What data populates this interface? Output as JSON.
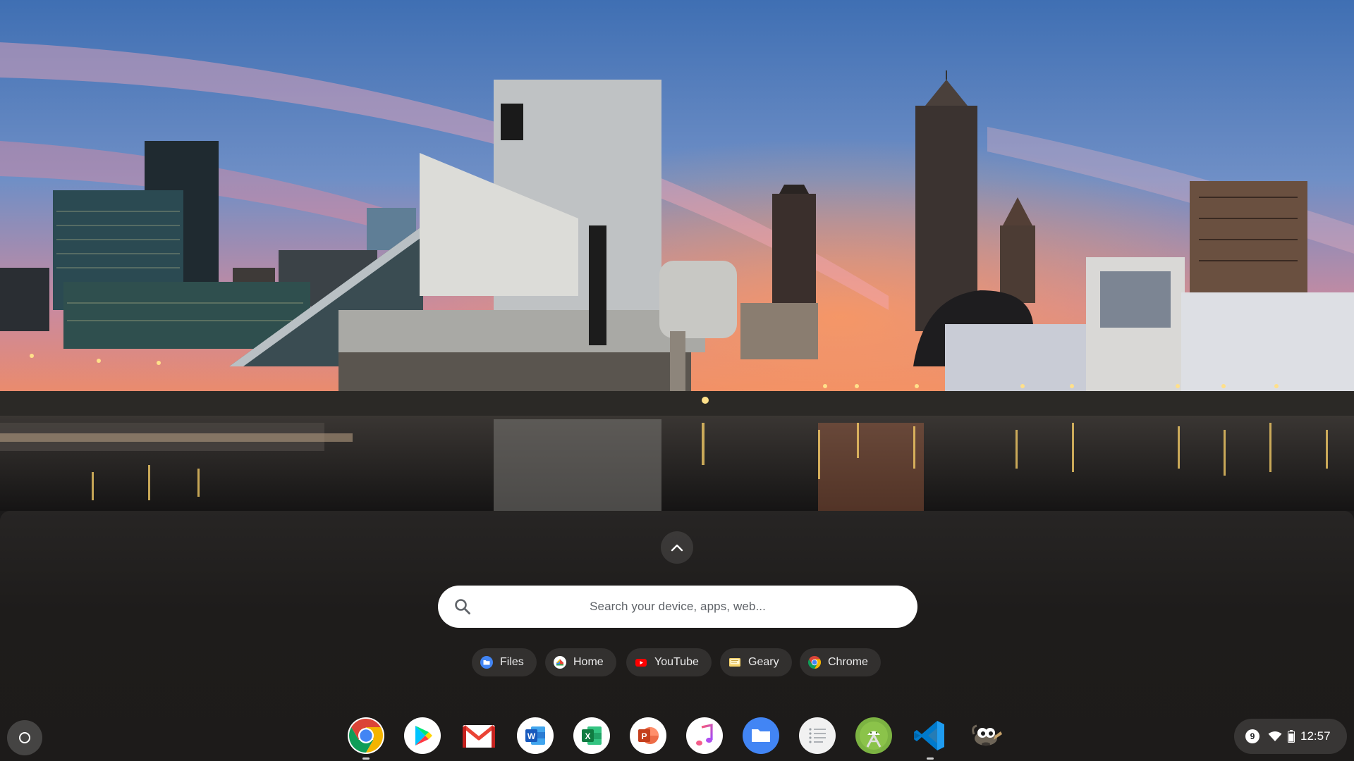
{
  "launcher": {
    "search_placeholder": "Search your device, apps, web...",
    "expand_icon": "chevron-up-icon",
    "search_icon": "search-icon"
  },
  "suggestions": [
    {
      "label": "Files",
      "icon": "files-icon"
    },
    {
      "label": "Home",
      "icon": "google-home-icon"
    },
    {
      "label": "YouTube",
      "icon": "youtube-icon"
    },
    {
      "label": "Geary",
      "icon": "geary-icon"
    },
    {
      "label": "Chrome",
      "icon": "chrome-icon"
    }
  ],
  "shelf": {
    "launcher_icon": "launcher-circle-icon",
    "apps": [
      {
        "icon": "chrome-icon",
        "running": true
      },
      {
        "icon": "play-store-icon",
        "running": false
      },
      {
        "icon": "gmail-icon",
        "running": false
      },
      {
        "icon": "word-icon",
        "running": false
      },
      {
        "icon": "excel-icon",
        "running": false
      },
      {
        "icon": "powerpoint-icon",
        "running": false
      },
      {
        "icon": "music-icon",
        "running": false
      },
      {
        "icon": "files-icon",
        "running": false
      },
      {
        "icon": "notes-list-icon",
        "running": false
      },
      {
        "icon": "android-studio-icon",
        "running": false
      },
      {
        "icon": "vscode-icon",
        "running": true
      },
      {
        "icon": "gimp-icon",
        "running": false
      }
    ]
  },
  "status": {
    "notification_count": "9",
    "time": "12:57",
    "wifi_icon": "wifi-icon",
    "battery_icon": "battery-icon"
  },
  "colors": {
    "launcher_bg": "#1d1b1a",
    "search_bg": "#ffffff",
    "chip_bg": "rgba(255,255,255,0.09)",
    "chrome_red": "#db4437",
    "chrome_yellow": "#f4b400",
    "chrome_green": "#0f9d58",
    "chrome_blue": "#4285f4"
  }
}
